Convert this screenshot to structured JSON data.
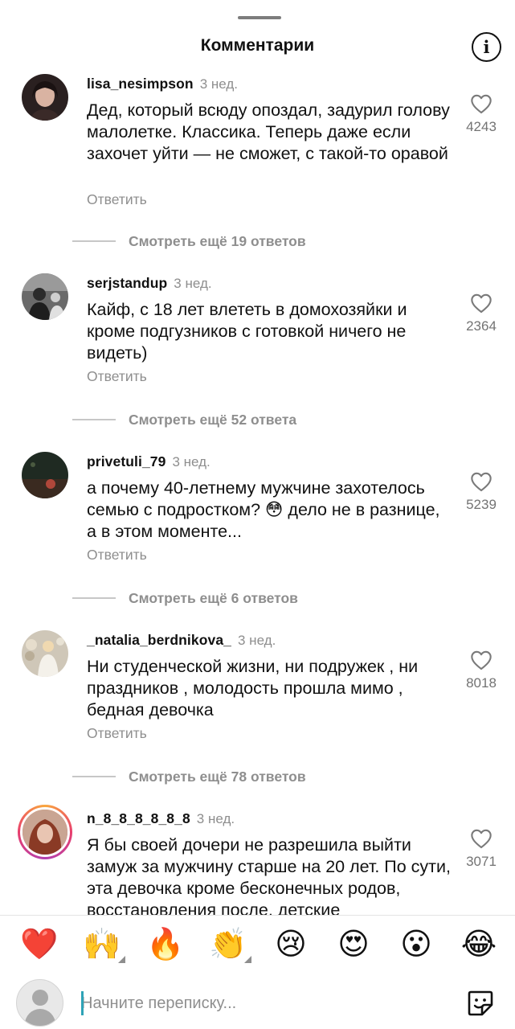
{
  "header": {
    "title": "Комментарии",
    "info_icon": "info-icon"
  },
  "comments": [
    {
      "username": "lisa_nesimpson",
      "time": "3 нед.",
      "text": "Дед, который всюду опоздал, задурил голову малолетке. Классика. Теперь даже если захочет уйти — не сможет, с такой-то оравой",
      "reply": "Ответить",
      "likes": "4243",
      "more_replies": "Смотреть ещё 19 ответов"
    },
    {
      "username": "serjstandup",
      "time": "3 нед.",
      "text": "Кайф, с 18 лет влететь в домохозяйки и кроме подгузников с готовкой ничего не видеть)",
      "reply": "Ответить",
      "likes": "2364",
      "more_replies": "Смотреть ещё 52 ответа"
    },
    {
      "username": "privetuli_79",
      "time": "3 нед.",
      "text": "а почему 40-летнему мужчине захотелось семью с подростком? 😳 дело не в разнице, а в этом моменте...",
      "reply": "Ответить",
      "likes": "5239",
      "more_replies": "Смотреть ещё 6 ответов"
    },
    {
      "username": "_natalia_berdnikova_",
      "time": "3 нед.",
      "text": "Ни студенческой жизни, ни подружек , ни праздников , молодость прошла мимо , бедная девочка",
      "reply": "Ответить",
      "likes": "8018",
      "more_replies": "Смотреть ещё 78 ответов"
    },
    {
      "username": "n_8_8_8_8_8_8",
      "time": "3 нед.",
      "text": "Я бы своей дочери не разрешила выйти замуж за мужчину старше на 20 лет. По сути, эта девочка кроме бесконечных родов, восстановления после, детские",
      "likes": "3071"
    }
  ],
  "reactions": [
    "❤️",
    "🙌",
    "🔥",
    "👏",
    "😢",
    "😍",
    "😮",
    "😂"
  ],
  "composer": {
    "placeholder": "Начните переписку...",
    "sticker_icon": "sticker-icon"
  },
  "colors": {
    "text": "#111111",
    "muted": "#8e8e8e",
    "story_ring": "#e83e6c",
    "caret": "#2fa3b7"
  }
}
